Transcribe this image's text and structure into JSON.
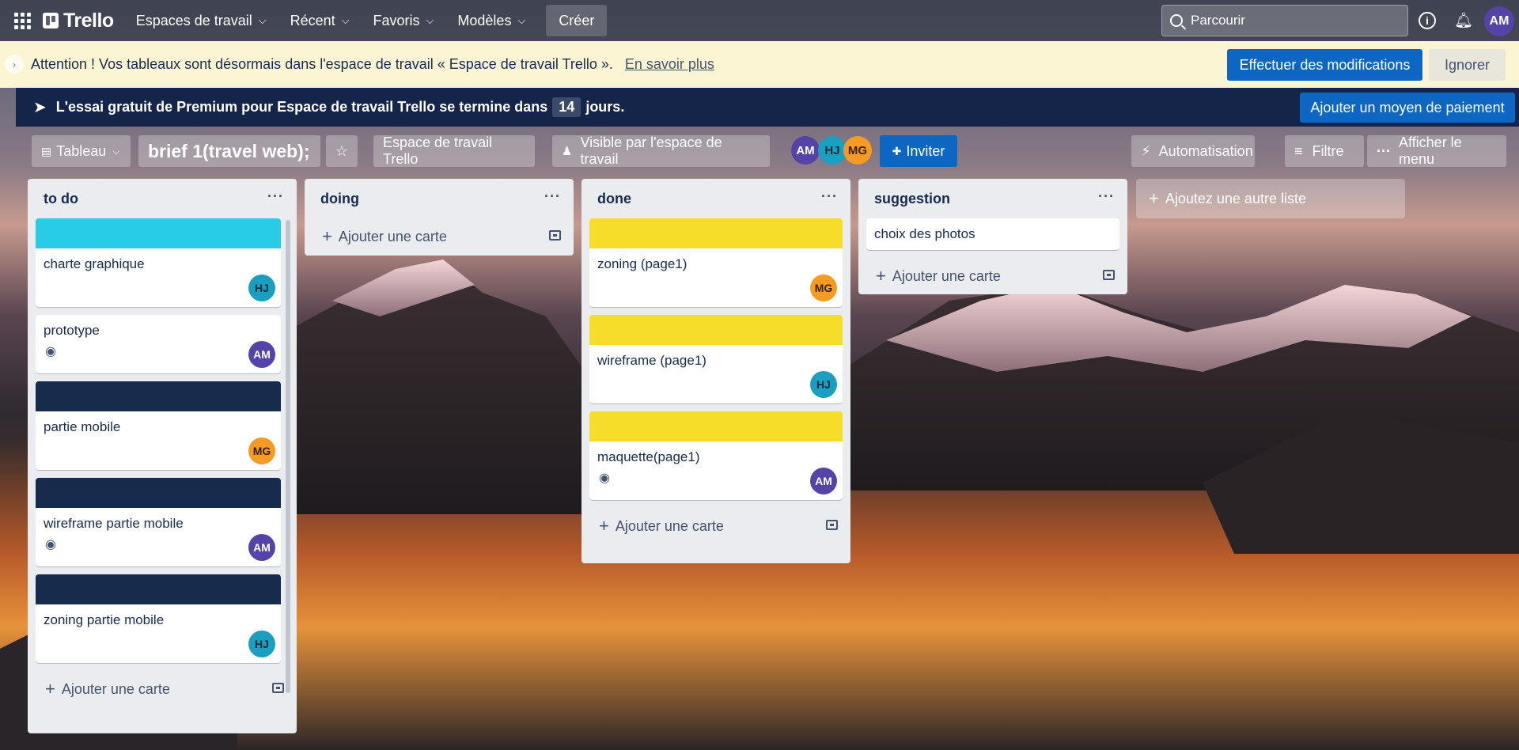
{
  "nav": {
    "logo": "Trello",
    "items": [
      {
        "label": "Espaces de travail"
      },
      {
        "label": "Récent"
      },
      {
        "label": "Favoris"
      },
      {
        "label": "Modèles"
      }
    ],
    "create": "Créer",
    "search_placeholder": "Parcourir",
    "user_initials": "AM"
  },
  "warning": {
    "text": "Attention ! Vos tableaux sont désormais dans l'espace de travail « Espace de travail Trello ».",
    "link": "En savoir plus",
    "primary": "Effectuer des modifications",
    "secondary": "Ignorer"
  },
  "premium": {
    "text_before": "L'essai gratuit de Premium pour Espace de travail Trello se termine dans",
    "days": "14",
    "text_after": "jours.",
    "button": "Ajouter un moyen de paiement"
  },
  "board": {
    "view": "Tableau",
    "title": "brief 1(travel web);",
    "workspace": "Espace de travail Trello",
    "visibility": "Visible par l'espace de travail",
    "members": [
      "AM",
      "HJ",
      "MG"
    ],
    "invite": "Inviter",
    "automation": "Automatisation",
    "filter": "Filtre",
    "menu": "Afficher le menu"
  },
  "lists": [
    {
      "title": "to do",
      "cards": [
        {
          "title": "charte graphique",
          "cover": "#29cce5",
          "member": "HJ"
        },
        {
          "title": "prototype",
          "member": "AM",
          "watch": true
        },
        {
          "title": "partie mobile",
          "cover": "#172b4d",
          "member": "MG"
        },
        {
          "title": "wireframe partie mobile",
          "cover": "#172b4d",
          "member": "AM",
          "watch": true
        },
        {
          "title": "zoning partie mobile",
          "cover": "#172b4d",
          "member": "HJ"
        }
      ],
      "add_label": "Ajouter une carte"
    },
    {
      "title": "doing",
      "cards": [],
      "add_label": "Ajouter une carte"
    },
    {
      "title": "done",
      "cards": [
        {
          "title": "zoning (page1)",
          "cover": "#f5dd29",
          "member": "MG"
        },
        {
          "title": "wireframe (page1)",
          "cover": "#f5dd29",
          "member": "HJ"
        },
        {
          "title": "maquette(page1)",
          "cover": "#f5dd29",
          "member": "AM",
          "watch": true
        }
      ],
      "add_label": "Ajouter une carte"
    },
    {
      "title": "suggestion",
      "cards": [
        {
          "title": "choix des photos"
        }
      ],
      "add_label": "Ajouter une carte"
    }
  ],
  "add_list": "Ajoutez une autre liste"
}
